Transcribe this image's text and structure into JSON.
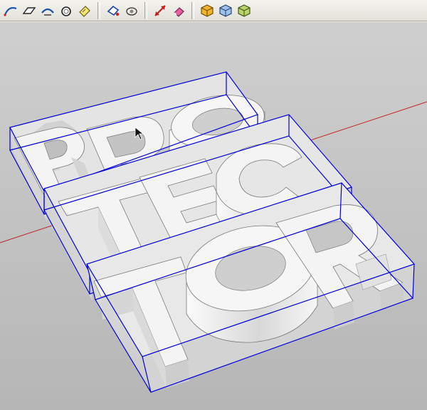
{
  "toolbar": {
    "groups": [
      {
        "name": "draw-tools",
        "tools": [
          "freehand-arc-icon",
          "plane-icon",
          "follow-me-icon",
          "circle-offset-icon",
          "paint-tag-icon"
        ]
      },
      {
        "name": "edit-tools",
        "tools": [
          "rotate-tool-icon",
          "orbit-tool-icon"
        ]
      },
      {
        "name": "measure-tools",
        "tools": [
          "dimension-arrow-icon",
          "eraser-icon"
        ]
      },
      {
        "name": "solid-tools",
        "tools": [
          "solid-union-icon",
          "solid-intersect-icon",
          "solid-subtract-icon"
        ]
      }
    ]
  },
  "viewport": {
    "model_lines": [
      "PRO",
      "TEC",
      "TOR"
    ],
    "colors": {
      "background": "#c4c4c4",
      "selection": "#0000dd",
      "face": "#f2f2f2",
      "shadow_face": "#cfcfcf",
      "axis_red": "#c02020"
    }
  }
}
